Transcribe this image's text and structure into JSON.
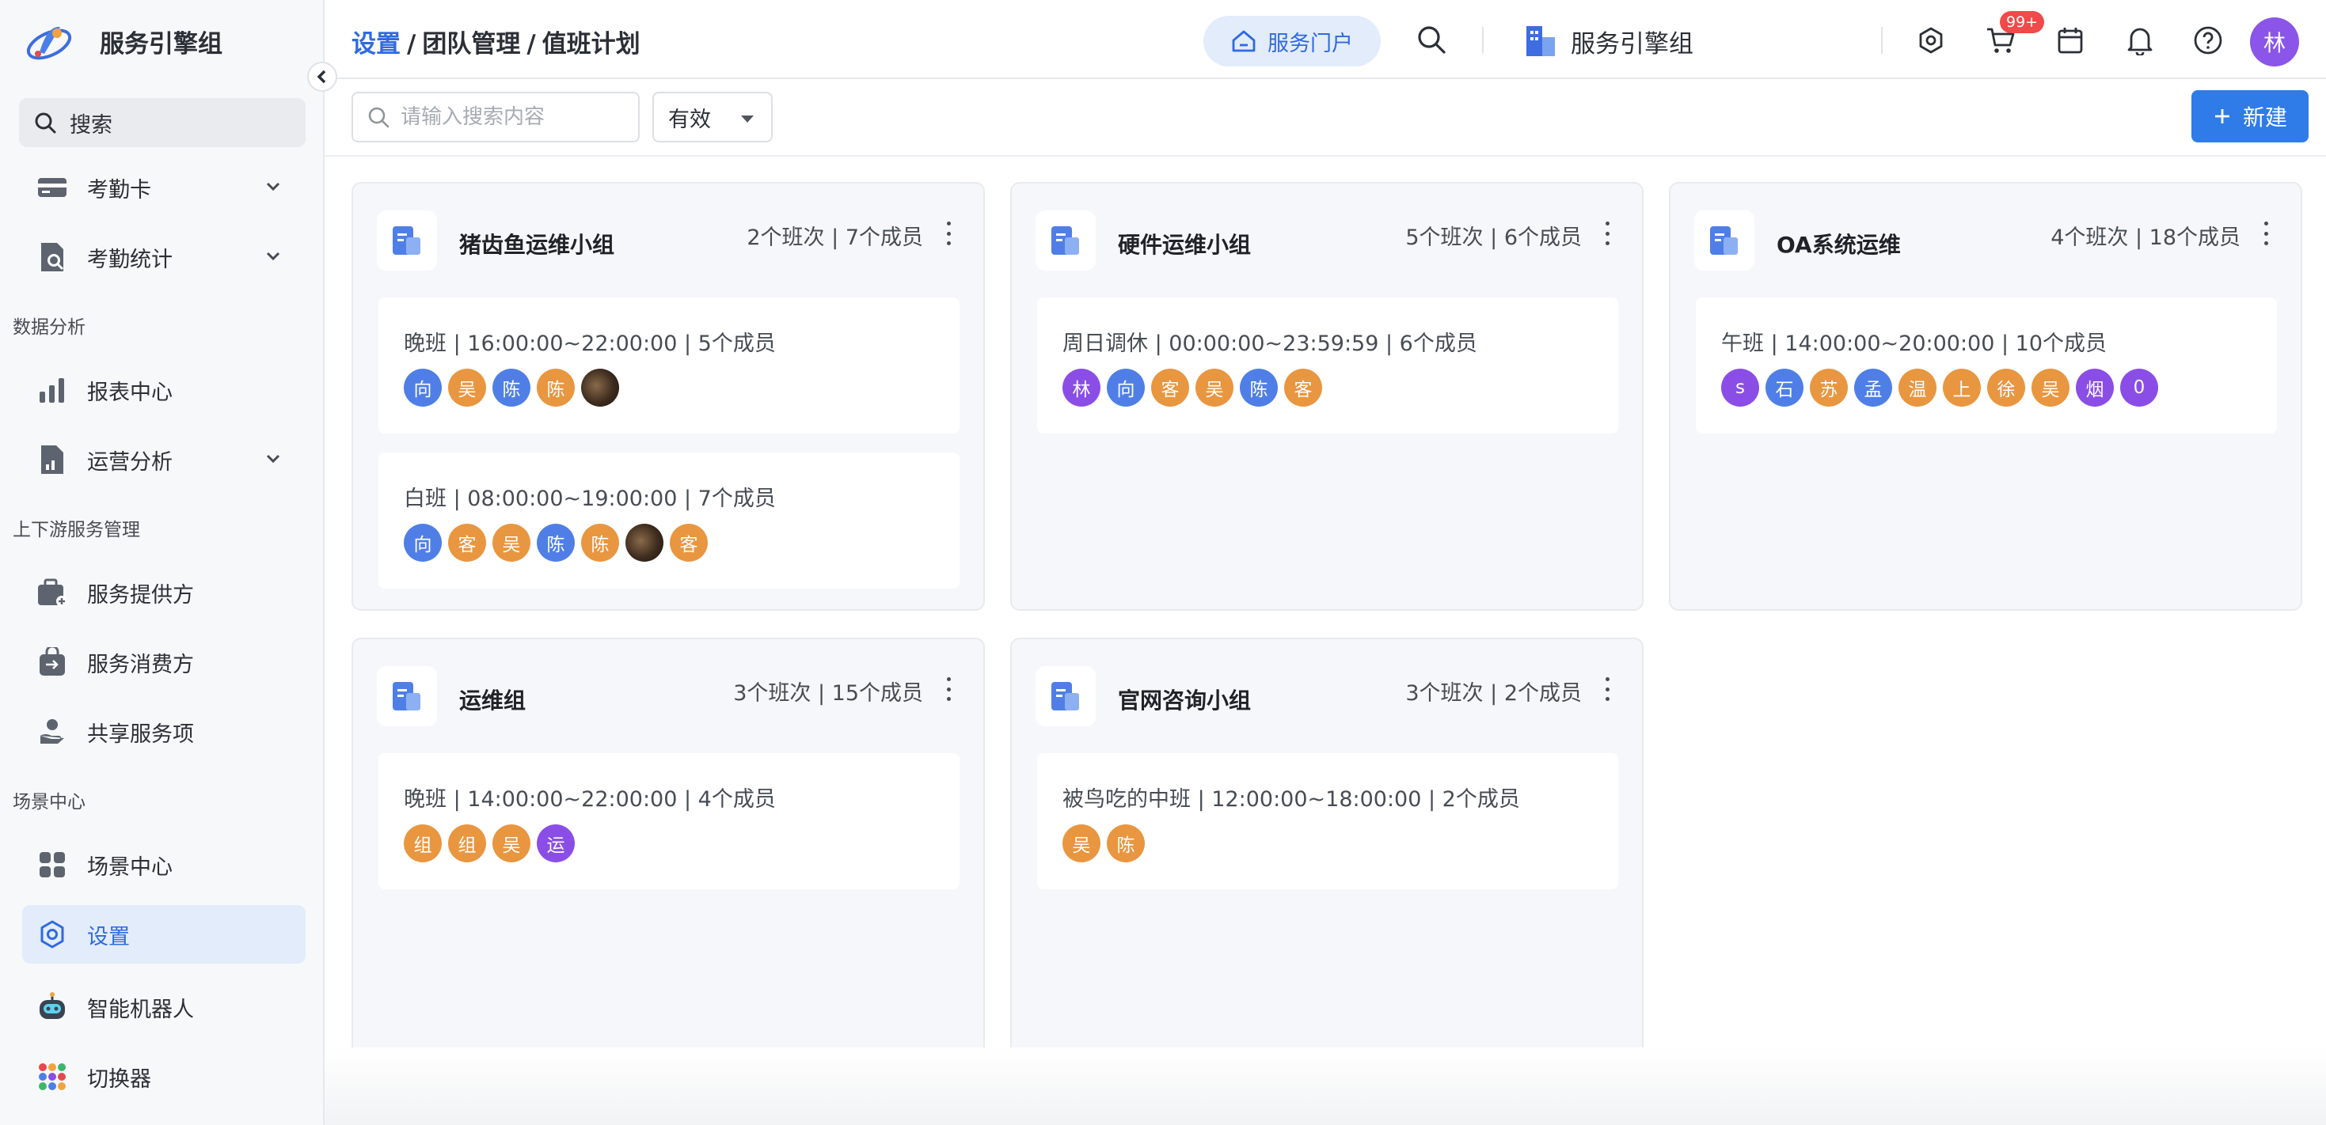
{
  "app": {
    "name": "服务引擎组"
  },
  "sidebar": {
    "search_label": "搜索",
    "sections": {
      "data_analysis": "数据分析",
      "upstream_downstream": "上下游服务管理",
      "scene_center": "场景中心"
    },
    "items": {
      "attendance_card": "考勤卡",
      "attendance_stats": "考勤统计",
      "report_center": "报表中心",
      "ops_analysis": "运营分析",
      "service_provider": "服务提供方",
      "service_consumer": "服务消费方",
      "shared_service": "共享服务项",
      "scene_center": "场景中心",
      "settings": "设置",
      "robot": "智能机器人",
      "switcher": "切换器"
    }
  },
  "header": {
    "breadcrumb": [
      "设置",
      "团队管理",
      "值班计划"
    ],
    "breadcrumb_sep": "/",
    "portal_label": "服务门户",
    "org_name": "服务引擎组",
    "notification_badge": "99+",
    "user_initial": "林"
  },
  "toolbar": {
    "search_placeholder": "请输入搜索内容",
    "status_value": "有效",
    "new_label": "新建"
  },
  "colors": {
    "accent": "#2f7be8",
    "member_blue": "#4f7fe6",
    "member_orange": "#e99640",
    "member_purple": "#8a4ee6"
  },
  "groups": [
    {
      "title": "猪齿鱼运维小组",
      "stats": "2个班次 | 7个成员",
      "shifts": [
        {
          "text": "晚班 | 16:00:00~22:00:00 | 5个成员",
          "members": [
            {
              "t": "向",
              "c": "blue"
            },
            {
              "t": "吴",
              "c": "orange"
            },
            {
              "t": "陈",
              "c": "blue"
            },
            {
              "t": "陈",
              "c": "orange"
            },
            {
              "t": "",
              "c": "photo"
            }
          ]
        },
        {
          "text": "白班 | 08:00:00~19:00:00 | 7个成员",
          "members": [
            {
              "t": "向",
              "c": "blue"
            },
            {
              "t": "客",
              "c": "orange"
            },
            {
              "t": "吴",
              "c": "orange"
            },
            {
              "t": "陈",
              "c": "blue"
            },
            {
              "t": "陈",
              "c": "orange"
            },
            {
              "t": "",
              "c": "photo"
            },
            {
              "t": "客",
              "c": "orange"
            }
          ]
        }
      ]
    },
    {
      "title": "硬件运维小组",
      "stats": "5个班次 | 6个成员",
      "shifts": [
        {
          "text": "周日调休 | 00:00:00~23:59:59 | 6个成员",
          "members": [
            {
              "t": "林",
              "c": "purple"
            },
            {
              "t": "向",
              "c": "blue"
            },
            {
              "t": "客",
              "c": "orange"
            },
            {
              "t": "吴",
              "c": "orange"
            },
            {
              "t": "陈",
              "c": "blue"
            },
            {
              "t": "客",
              "c": "orange"
            }
          ]
        }
      ]
    },
    {
      "title": "OA系统运维",
      "stats": "4个班次 | 18个成员",
      "shifts": [
        {
          "text": "午班 | 14:00:00~20:00:00 | 10个成员",
          "members": [
            {
              "t": "s",
              "c": "purple"
            },
            {
              "t": "石",
              "c": "blue"
            },
            {
              "t": "苏",
              "c": "orange"
            },
            {
              "t": "孟",
              "c": "blue"
            },
            {
              "t": "温",
              "c": "orange"
            },
            {
              "t": "上",
              "c": "orange"
            },
            {
              "t": "徐",
              "c": "orange"
            },
            {
              "t": "吴",
              "c": "orange"
            },
            {
              "t": "烟",
              "c": "purple"
            },
            {
              "t": "0",
              "c": "purple"
            }
          ]
        }
      ]
    },
    {
      "title": "运维组",
      "stats": "3个班次 | 15个成员",
      "shifts": [
        {
          "text": "晚班 | 14:00:00~22:00:00 | 4个成员",
          "members": [
            {
              "t": "组",
              "c": "orange"
            },
            {
              "t": "组",
              "c": "orange"
            },
            {
              "t": "吴",
              "c": "orange"
            },
            {
              "t": "运",
              "c": "purple"
            }
          ]
        }
      ]
    },
    {
      "title": "官网咨询小组",
      "stats": "3个班次 | 2个成员",
      "shifts": [
        {
          "text": "被鸟吃的中班 | 12:00:00~18:00:00 | 2个成员",
          "members": [
            {
              "t": "吴",
              "c": "orange"
            },
            {
              "t": "陈",
              "c": "orange"
            }
          ]
        }
      ]
    }
  ]
}
